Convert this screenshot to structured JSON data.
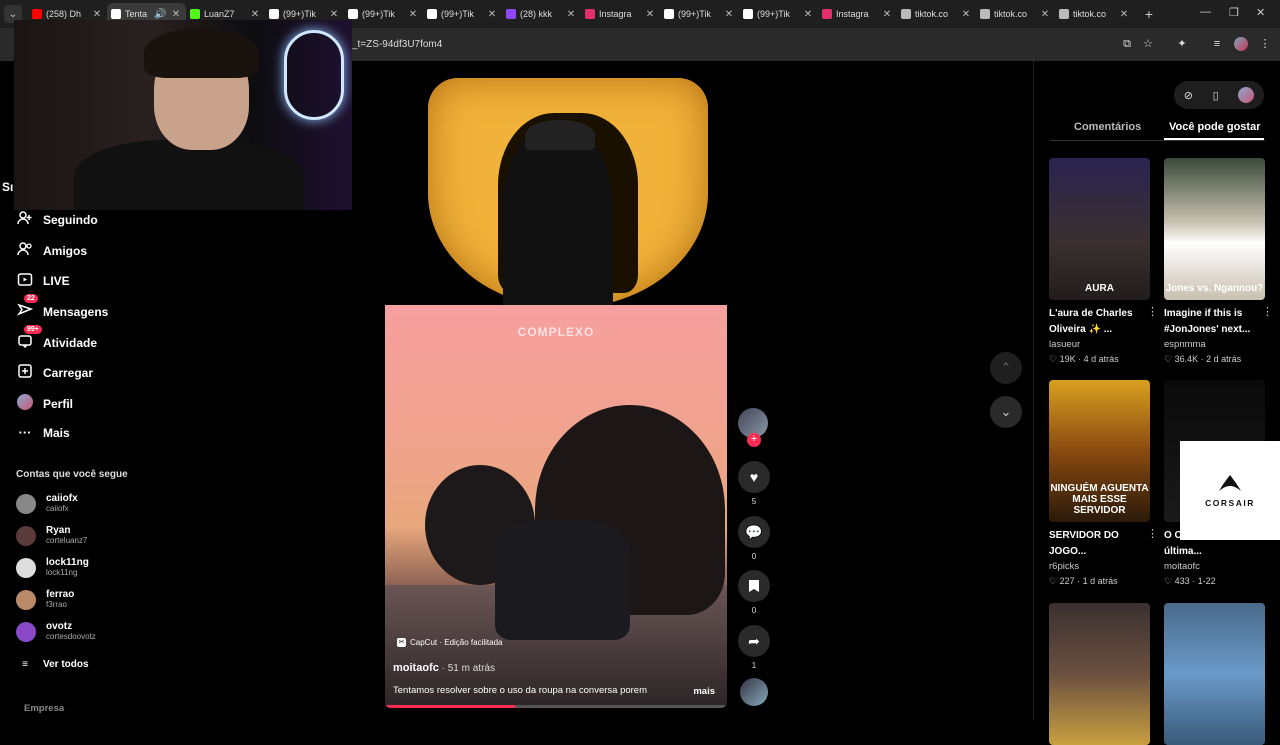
{
  "browser": {
    "tabs": [
      {
        "title": "(258) Dh",
        "favicon_color": "#ff0000",
        "active": false
      },
      {
        "title": "Tenta",
        "favicon_color": "#ffffff",
        "active": true
      },
      {
        "title": "LuanZ7",
        "favicon_color": "#53fc18",
        "active": false
      },
      {
        "title": "(99+)Tik",
        "favicon_color": "#ffffff",
        "active": false
      },
      {
        "title": "(99+)Tik",
        "favicon_color": "#ffffff",
        "active": false
      },
      {
        "title": "(99+)Tik",
        "favicon_color": "#ffffff",
        "active": false
      },
      {
        "title": "(28) kkk",
        "favicon_color": "#9146ff",
        "active": false
      },
      {
        "title": "Instagra",
        "favicon_color": "#e1306c",
        "active": false
      },
      {
        "title": "(99+)Tik",
        "favicon_color": "#ffffff",
        "active": false
      },
      {
        "title": "(99+)Tik",
        "favicon_color": "#ffffff",
        "active": false
      },
      {
        "title": "Instagra",
        "favicon_color": "#e1306c",
        "active": false
      },
      {
        "title": "tiktok.co",
        "favicon_color": "#bbbbbb",
        "active": false
      },
      {
        "title": "tiktok.co",
        "favicon_color": "#bbbbbb",
        "active": false
      },
      {
        "title": "tiktok.co",
        "favicon_color": "#bbbbbb",
        "active": false
      }
    ],
    "url_fragment": "_t=ZS-94df3U7fom4"
  },
  "sidebar": {
    "cut_letters": "Sı",
    "nav": [
      {
        "label": "Seguindo",
        "icon": "person-follow-icon"
      },
      {
        "label": "Amigos",
        "icon": "friends-icon"
      },
      {
        "label": "LIVE",
        "icon": "live-icon"
      },
      {
        "label": "Mensagens",
        "icon": "messages-icon",
        "badge": "22"
      },
      {
        "label": "Atividade",
        "icon": "activity-icon",
        "badge": "99+"
      },
      {
        "label": "Carregar",
        "icon": "upload-icon"
      },
      {
        "label": "Perfil",
        "icon": "profile-avatar"
      },
      {
        "label": "Mais",
        "icon": "more-icon"
      }
    ],
    "following_title": "Contas que você segue",
    "following": [
      {
        "name": "caiiofx",
        "handle": "caiiofx",
        "color": "#888888"
      },
      {
        "name": "Ryan",
        "handle": "corteluanz7",
        "color": "#5a3a3a"
      },
      {
        "name": "lock11ng",
        "handle": "lock11ng",
        "color": "#dddddd"
      },
      {
        "name": "ferrao",
        "handle": "f3rrao",
        "color": "#b88a6a"
      },
      {
        "name": "ovotz",
        "handle": "cortesdoovotz",
        "color": "#8a4ac8"
      }
    ],
    "see_all": "Ver todos",
    "footer": "Empresa"
  },
  "video": {
    "watermark_top": "COMPLEXO",
    "capcut": "CapCut · Edição facilitada",
    "author": "moitaofc",
    "time": " · 51 m atrás",
    "description": "Tentamos resolver sobre o uso da roupa na conversa porem",
    "more": "mais",
    "progress": 0.38
  },
  "actions": {
    "likes": "5",
    "comments": "0",
    "saves": "0",
    "shares": "1"
  },
  "right_panel": {
    "tab_comments": "Comentários",
    "tab_recommend": "Você pode gostar",
    "cards": [
      {
        "title": "L'aura de Charles Oliveira ✨ ...",
        "author": "lasueur",
        "likes": "19K",
        "ago": "4 d atrás",
        "thumb_text": "AURA",
        "bg": "linear-gradient(180deg,#2a2450,#3a3030 60%,#221c1c)"
      },
      {
        "title": "Imagine if this is #JonJones' next...",
        "author": "espnmma",
        "likes": "36.4K",
        "ago": "2 d atrás",
        "thumb_text": "Jones vs. Ngannou?",
        "bg": "linear-gradient(180deg,#3a4a3a,#c8c0b0 45%,#ffffff 60%,#c8c0b0)"
      },
      {
        "title": "SERVIDOR DO JOGO...",
        "author": "r6picks",
        "likes": "227",
        "ago": "1 d atrás",
        "thumb_text": "NINGUÉM AGUENTA MAIS ESSE SERVIDOR",
        "bg": "linear-gradient(180deg,#d8a020,#8a4a10 50%,#2a1a0a)"
      },
      {
        "title": "O C... 2026 for a última...",
        "author": "moitaofc",
        "likes": "433",
        "ago": "1-22",
        "thumb_text": "",
        "bg": "linear-gradient(180deg,#0a0a0a,#1a1a1a)"
      },
      {
        "title": "",
        "author": "",
        "likes": "",
        "ago": "",
        "thumb_text": "",
        "bg": "linear-gradient(180deg,#3a3030,#6a5040 50%,#c8a040)"
      },
      {
        "title": "",
        "author": "",
        "likes": "",
        "ago": "",
        "thumb_text": "",
        "bg": "linear-gradient(180deg,#4a6a8a,#6a9ac8 50%,#3a5a7a)"
      }
    ]
  },
  "ad": {
    "brand": "CORSAIR"
  }
}
